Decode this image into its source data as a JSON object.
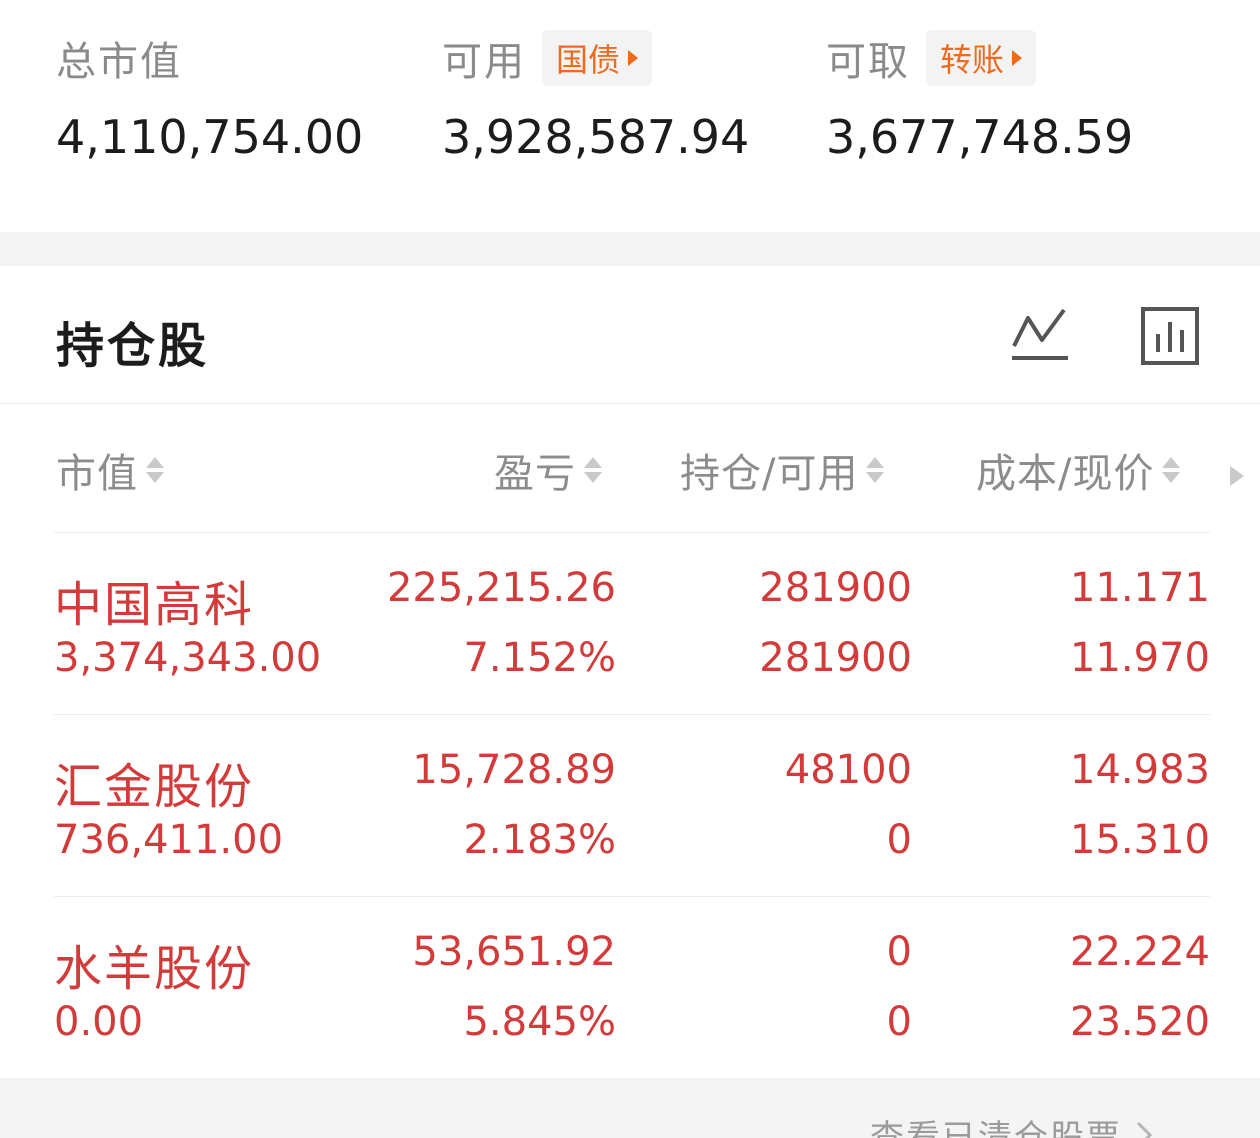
{
  "summary": {
    "total_market_value": {
      "label": "总市值",
      "value": "4,110,754.00"
    },
    "available": {
      "label": "可用",
      "tag": "国债",
      "value": "3,928,587.94"
    },
    "withdrawable": {
      "label": "可取",
      "tag": "转账",
      "value": "3,677,748.59"
    }
  },
  "holdings": {
    "title": "持仓股",
    "icons": {
      "trend": "line-chart-icon",
      "bar": "bar-chart-icon"
    },
    "columns": {
      "market_value": "市值",
      "profit_loss": "盈亏",
      "position_available": "持仓/可用",
      "cost_price": "成本/现价"
    },
    "rows": [
      {
        "name": "中国高科",
        "market_value": "3,374,343.00",
        "profit": "225,215.26",
        "profit_pct": "7.152%",
        "position": "281900",
        "available": "281900",
        "cost": "11.171",
        "price": "11.970"
      },
      {
        "name": "汇金股份",
        "market_value": "736,411.00",
        "profit": "15,728.89",
        "profit_pct": "2.183%",
        "position": "48100",
        "available": "0",
        "cost": "14.983",
        "price": "15.310"
      },
      {
        "name": "水羊股份",
        "market_value": "0.00",
        "profit": "53,651.92",
        "profit_pct": "5.845%",
        "position": "0",
        "available": "0",
        "cost": "22.224",
        "price": "23.520"
      }
    ]
  },
  "footer": {
    "link_label": "查看已清仓股票"
  },
  "colors": {
    "accent_orange": "#f06a1c",
    "gain_red": "#d33a3a",
    "muted": "#8c8c8c"
  }
}
